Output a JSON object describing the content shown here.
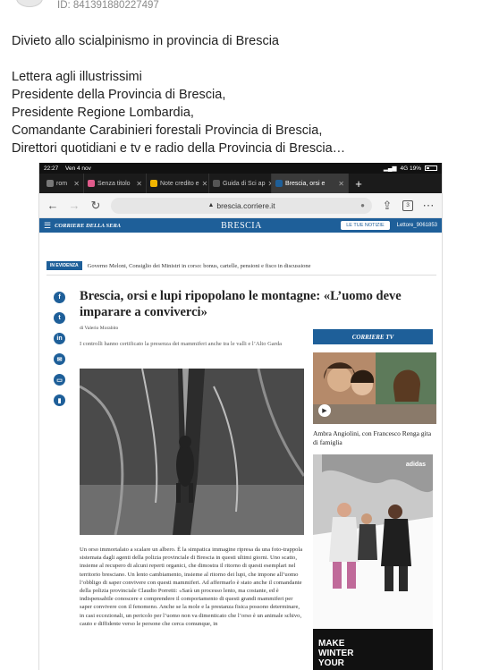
{
  "post": {
    "id_text": "ID: 841391880227497",
    "title": "Divieto allo scialpinismo in provincia di Brescia",
    "letter": [
      "Lettera agli illustrissimi",
      "Presidente della Provincia di Brescia,",
      "Presidente Regione Lombardia,",
      "Comandante Carabinieri forestali Provincia di Brescia,",
      "Direttori quotidiani e tv e radio della Provincia di Brescia…"
    ]
  },
  "screenshot": {
    "status": {
      "time": "22:27",
      "date": "Ven 4 nov",
      "network": "4G 19%"
    },
    "tabs": [
      {
        "label": "rom"
      },
      {
        "label": "Senza titolo"
      },
      {
        "label": "Note credito e"
      },
      {
        "label": "Guida di Sci ap"
      },
      {
        "label": "Brescia, orsi e"
      }
    ],
    "new_tab": "+",
    "url": "brescia.corriere.it",
    "tab_count": "3",
    "site": {
      "logo": "CORRIERE DELLA SERA",
      "section": "BRESCIA",
      "news_button": "LE TUE NOTIZIE",
      "user": "Lettore_9061853"
    },
    "evidenza": {
      "tag": "IN EVIDENZA",
      "text": "Governo Meloni, Consiglio dei Ministri in corso: bonus, cartelle, pensioni e fisco in discussione"
    },
    "article": {
      "headline": "Brescia, orsi e lupi ripopolano le montagne: «L’uomo deve imparare a conviverci»",
      "byline": "di Valerio Morabito",
      "lede": "I controlli hanno certificato la presenza dei mammiferi anche tra le valli e l’Alto Garda",
      "body": "Un orso immortalato a scalare un albero. È la simpatica immagine ripresa da una foto-trappola sistemata dagli agenti della polizia provinciale di Brescia in questi ultimi giorni. Uno scatto, insieme al recupero di alcuni reperti organici, che dimostra il ritorno di questi esemplari nel territorio bresciano. Un lento cambiamento, insieme al ritorno dei lupi, che impone all’uomo l’obbligo di saper convivere con questi mammiferi. Ad affermarlo è stato anche il comandante della polizia provinciale Claudio Porretti: «Sarà un processo lento, ma costante, ed è indispensabile conoscere e comprendere il comportamento di questi grandi mammiferi per saper convivere con il fenomeno. Anche se la mole e la prestanza fisica possono determinare, in casi eccezionali, un pericolo per l’uomo non va dimenticato che l’orso è un animale schivo, cauto e diffidente verso le persone che cerca comunque, in"
    },
    "sidebar": {
      "tv_label": "CORRIERE TV",
      "video_caption": "Ambra Angiolini, con Francesco Renga gita di famiglia",
      "ad_text": "MAKE WINTER YOUR",
      "ad_brand": "adidas"
    },
    "colors": {
      "brand": "#1e5f99",
      "chrome_dark": "#1b1b1b"
    }
  }
}
